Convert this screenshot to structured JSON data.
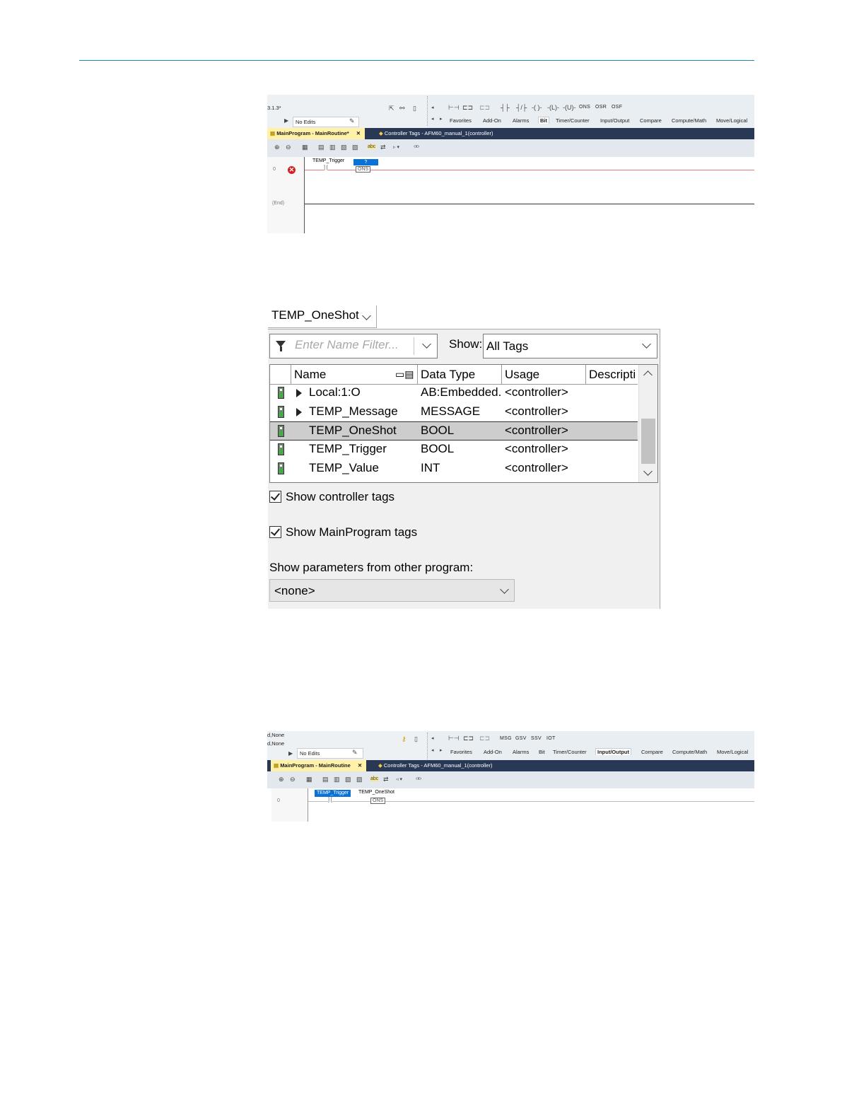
{
  "screenshot1": {
    "version_text": "3.1.3*",
    "edits_status": "No Edits",
    "instructions": [
      "ONS",
      "OSR",
      "OSF"
    ],
    "categories": [
      "Favorites",
      "Add-On",
      "Alarms",
      "Bit",
      "Timer/Counter",
      "Input/Output",
      "Compare",
      "Compute/Math",
      "Move/Logical"
    ],
    "selected_category": "Bit",
    "active_tab": "MainProgram - MainRoutine*",
    "other_tab": "Controller Tags - AFM60_manual_1(controller)",
    "rung_number": "0",
    "end_label": "(End)",
    "contact_tag": "TEMP_Trigger",
    "ons_operand": "?",
    "ons_label": "ONS"
  },
  "tag_browser": {
    "selected_tag": "TEMP_OneShot",
    "filter_placeholder": "Enter Name Filter...",
    "show_label": "Show:",
    "show_value": "All Tags",
    "columns": [
      "Name",
      "Data Type",
      "Usage",
      "Descripti"
    ],
    "rows": [
      {
        "name": "Local:1:O",
        "type": "AB:Embedded...",
        "usage": "<controller>",
        "expandable": true,
        "selected": false
      },
      {
        "name": "TEMP_Message",
        "type": "MESSAGE",
        "usage": "<controller>",
        "expandable": true,
        "selected": false
      },
      {
        "name": "TEMP_OneShot",
        "type": "BOOL",
        "usage": "<controller>",
        "expandable": false,
        "selected": true
      },
      {
        "name": "TEMP_Trigger",
        "type": "BOOL",
        "usage": "<controller>",
        "expandable": false,
        "selected": false
      },
      {
        "name": "TEMP_Value",
        "type": "INT",
        "usage": "<controller>",
        "expandable": false,
        "selected": false
      }
    ],
    "show_controller_tags": "Show controller tags",
    "show_mainprogram_tags": "Show MainProgram tags",
    "show_params_label": "Show parameters from other program:",
    "params_value": "<none>"
  },
  "screenshot3": {
    "version_lines": [
      "d,None",
      "d,None"
    ],
    "edits_status": "No Edits",
    "instructions": [
      "MSG",
      "GSV",
      "SSV",
      "IOT"
    ],
    "categories": [
      "Favorites",
      "Add-On",
      "Alarms",
      "Bit",
      "Timer/Counter",
      "Input/Output",
      "Compare",
      "Compute/Math",
      "Move/Logical"
    ],
    "selected_category": "Input/Output",
    "active_tab": "MainProgram - MainRoutine",
    "other_tab": "Controller Tags - AFM60_manual_1(controller)",
    "rung_number": "0",
    "contact_tag": "TEMP_Trigger",
    "ons_tag": "TEMP_OneShot",
    "ons_label": "ONS"
  },
  "colors": {
    "rule": "#1f8fb0",
    "tab_bar": "#293955",
    "active_tab": "#fff1a8",
    "error_rung": "#d32020",
    "selected_operand": "#0a72d6"
  }
}
